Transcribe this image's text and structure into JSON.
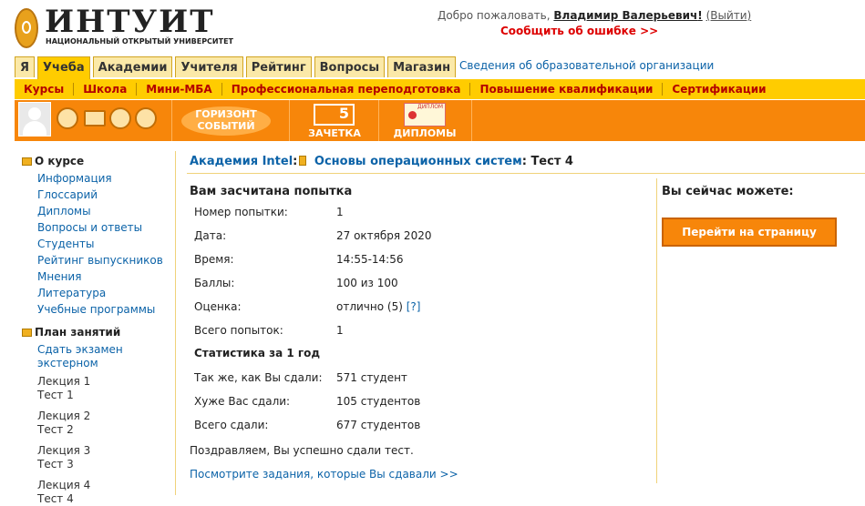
{
  "header": {
    "logo_text": "ИНТУИТ",
    "logo_sub": "НАЦИОНАЛЬНЫЙ ОТКРЫТЫЙ УНИВЕРСИТЕТ",
    "welcome_prefix": "Добро пожаловать,",
    "user_name": "Владимир Валерьевич",
    "exit": "(Выйти)",
    "report_error": "Сообщить об ошибке >>"
  },
  "tabs": [
    {
      "label": "Я"
    },
    {
      "label": "Учеба",
      "active": true
    },
    {
      "label": "Академии"
    },
    {
      "label": "Учителя"
    },
    {
      "label": "Рейтинг"
    },
    {
      "label": "Вопросы"
    },
    {
      "label": "Магазин"
    }
  ],
  "org_link": "Сведения об образовательной организации",
  "subnav": [
    "Курсы",
    "Школа",
    "Мини-МБА",
    "Профессиональная переподготовка",
    "Повышение квалификации",
    "Сертификации"
  ],
  "orange_bar": {
    "icons": [
      "avatar-icon",
      "alarm-clock-icon",
      "envelope-icon",
      "people-icon",
      "bell-icon"
    ],
    "gorizont_line1": "ГОРИЗОНТ",
    "gorizont_line2": "СОБЫТИЙ",
    "zachetka_number": "5",
    "zachetka_label": "ЗАЧЕТКА",
    "diplomy_label": "ДИПЛОМЫ",
    "diplom_caption": "ДИПЛОМ"
  },
  "sidebar": {
    "about_title": "О курсе",
    "about_items": [
      "Информация",
      "Глоссарий",
      "Дипломы",
      "Вопросы и ответы",
      "Студенты",
      "Рейтинг выпускников",
      "Мнения",
      "Литература",
      "Учебные программы"
    ],
    "plan_title": "План занятий",
    "exam_link_line1": "Сдать экзамен",
    "exam_link_line2": "экстерном",
    "lectures": [
      {
        "lecture": "Лекция 1",
        "test": "Тест 1"
      },
      {
        "lecture": "Лекция 2",
        "test": "Тест 2"
      },
      {
        "lecture": "Лекция 3",
        "test": "Тест 3"
      },
      {
        "lecture": "Лекция 4",
        "test": "Тест 4"
      }
    ]
  },
  "breadcrumb": {
    "academy": "Академия Intel",
    "course": "Основы операционных систем",
    "current": "Тест 4"
  },
  "result": {
    "title": "Вам засчитана попытка",
    "rows": [
      {
        "label": "Номер попытки:",
        "value": "1"
      },
      {
        "label": "Дата:",
        "value": "27 октября 2020"
      },
      {
        "label": "Время:",
        "value": "14:55-14:56"
      },
      {
        "label": "Баллы:",
        "value": "100 из 100"
      },
      {
        "label": "Оценка:",
        "value": "отлично (5)",
        "help": "[?]"
      },
      {
        "label": "Всего попыток:",
        "value": "1"
      }
    ],
    "stats_title": "Статистика за 1 год",
    "stats": [
      {
        "label": "Так же, как Вы сдали:",
        "value": "571 студент"
      },
      {
        "label": "Хуже Вас сдали:",
        "value": "105 студентов"
      },
      {
        "label": "Всего сдали:",
        "value": "677 студентов"
      }
    ],
    "congrats": "Поздравляем, Вы успешно сдали тест.",
    "see_tasks": "Посмотрите задания, которые Вы сдавали >>"
  },
  "actions": {
    "title": "Вы сейчас можете:",
    "go_course": "Перейти на страницу курса"
  }
}
